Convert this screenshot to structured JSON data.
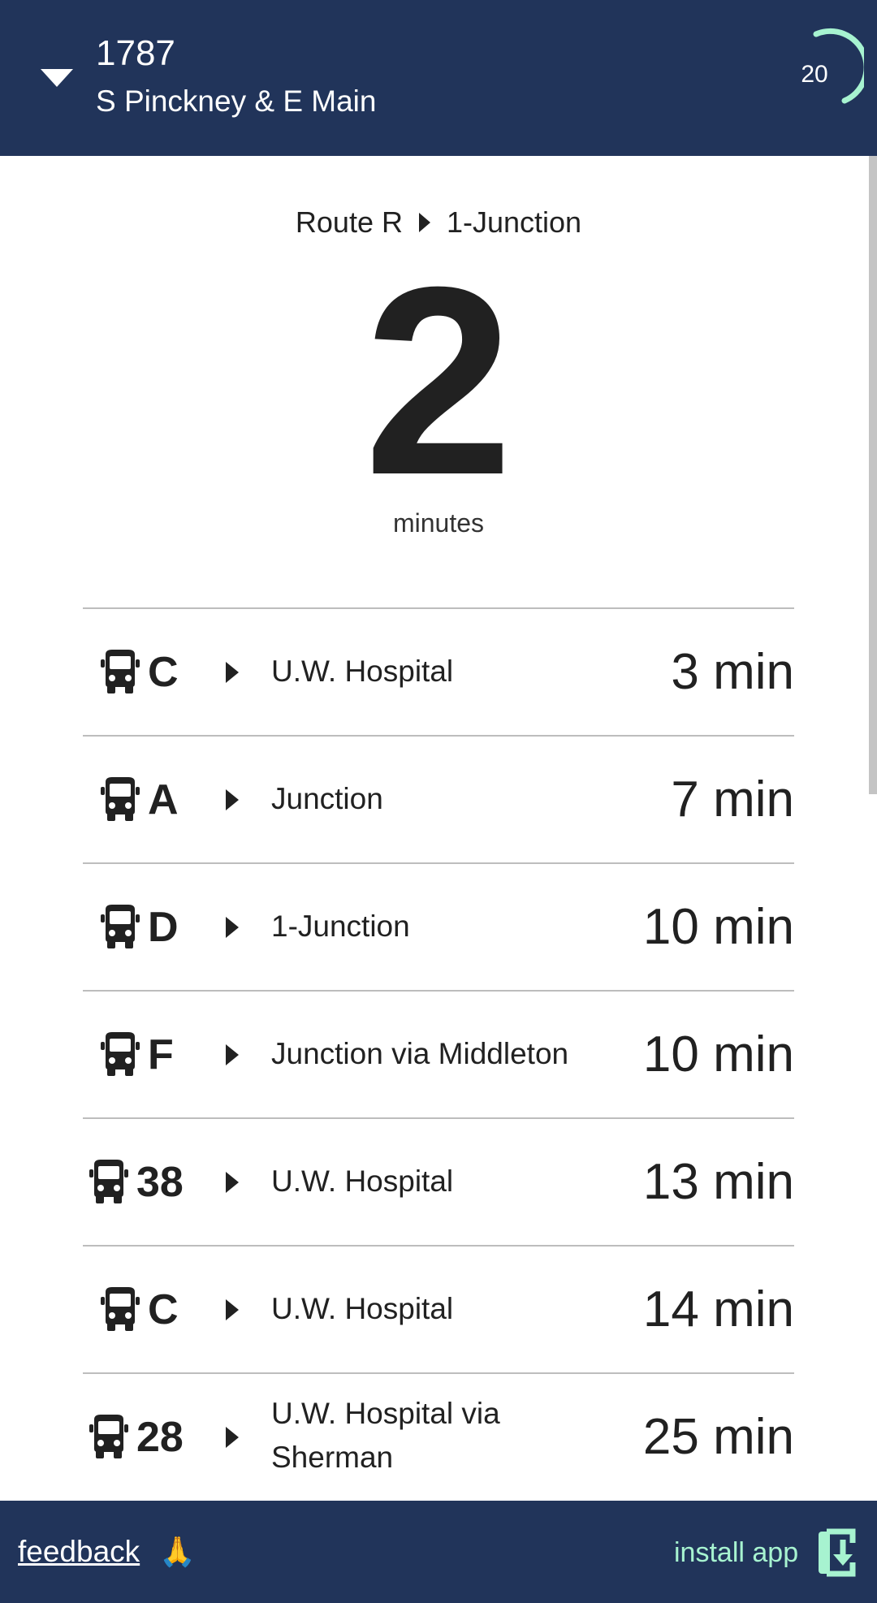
{
  "header": {
    "stop_id": "1787",
    "stop_name": "S Pinckney & E Main",
    "refresh_countdown": "20",
    "collapse_icon": "caret-down-icon",
    "refresh_icon": "circular-progress-icon",
    "background": "#21345a",
    "accent": "#a7f3d0"
  },
  "next_arrival": {
    "route_label": "Route R",
    "destination": "1-Junction",
    "minutes": "2",
    "minutes_label": "minutes"
  },
  "arrivals": [
    {
      "route": "C",
      "destination": "U.W. Hospital",
      "time": "3 min",
      "icon": "bus-icon"
    },
    {
      "route": "A",
      "destination": "Junction",
      "time": "7 min",
      "icon": "bus-icon"
    },
    {
      "route": "D",
      "destination": "1-Junction",
      "time": "10 min",
      "icon": "bus-icon"
    },
    {
      "route": "F",
      "destination": "Junction via Middleton",
      "time": "10 min",
      "icon": "bus-icon"
    },
    {
      "route": "38",
      "destination": "U.W. Hospital",
      "time": "13 min",
      "icon": "bus-icon"
    },
    {
      "route": "C",
      "destination": "U.W. Hospital",
      "time": "14 min",
      "icon": "bus-icon"
    },
    {
      "route": "28",
      "destination": "U.W. Hospital via Sherman",
      "time": "25 min",
      "icon": "bus-icon"
    }
  ],
  "footer": {
    "feedback_label": "feedback",
    "feedback_emoji": "🙏",
    "install_label": "install app",
    "install_icon": "install-download-icon"
  }
}
